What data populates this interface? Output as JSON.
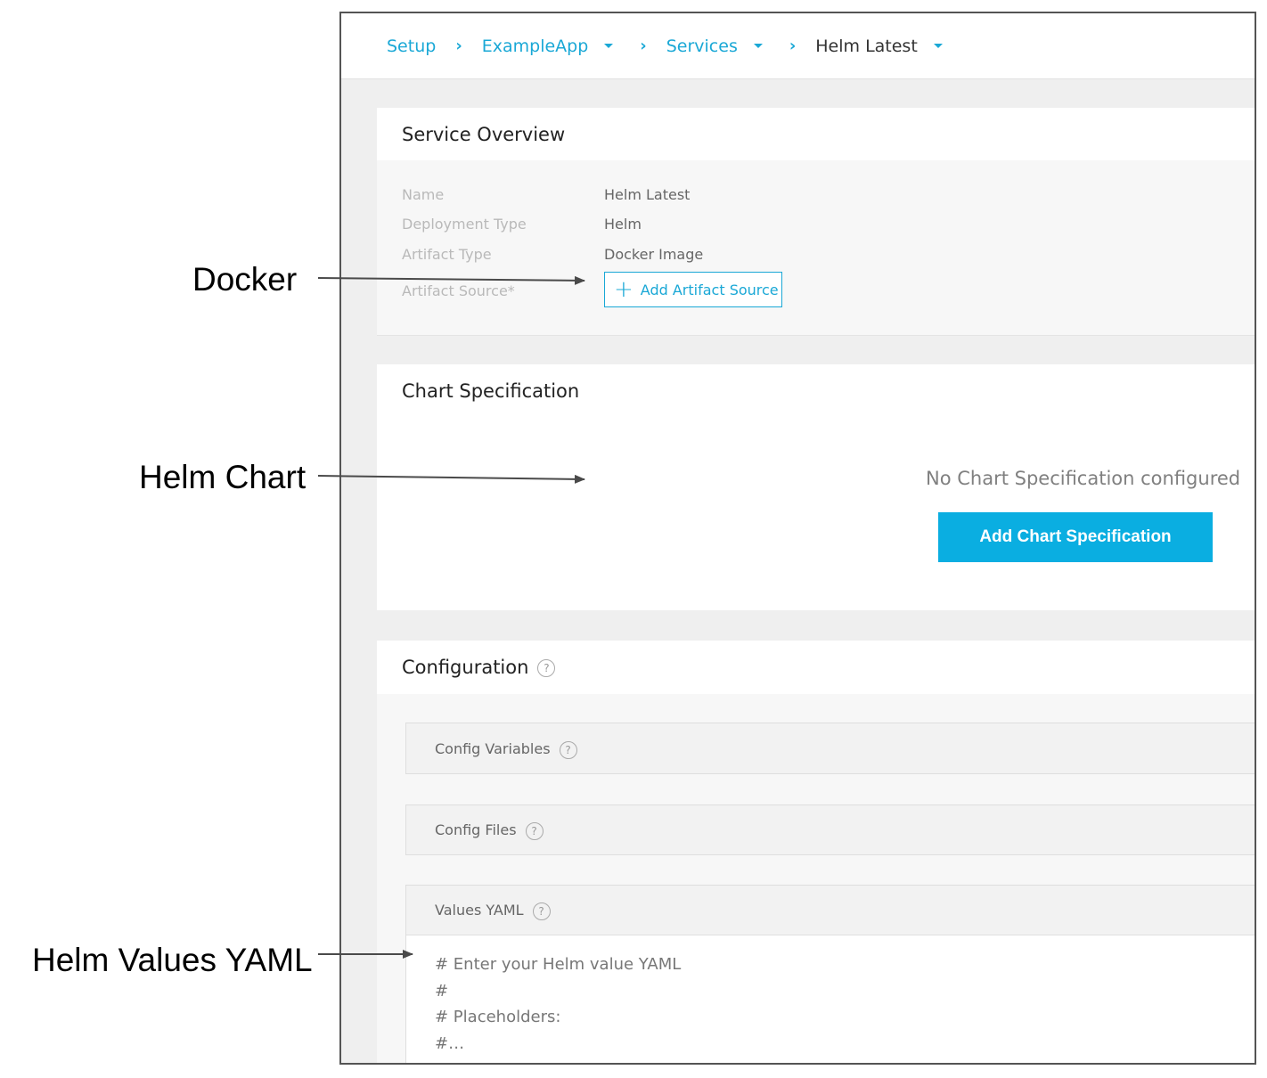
{
  "callouts": {
    "docker": "Docker",
    "helm_chart": "Helm Chart",
    "helm_values": "Helm Values YAML"
  },
  "breadcrumb": {
    "setup": "Setup",
    "app": "ExampleApp",
    "services": "Services",
    "current": "Helm Latest"
  },
  "service_overview": {
    "title": "Service Overview",
    "rows": [
      {
        "label": "Name",
        "value": "Helm Latest"
      },
      {
        "label": "Deployment Type",
        "value": "Helm"
      },
      {
        "label": "Artifact Type",
        "value": "Docker Image"
      },
      {
        "label": "Artifact Source*"
      }
    ],
    "add_artifact_label": "Add Artifact Source"
  },
  "chart_spec": {
    "title": "Chart Specification",
    "empty_text": "No Chart Specification configured",
    "add_button": "Add Chart Specification"
  },
  "configuration": {
    "title": "Configuration",
    "help_glyph": "?",
    "config_variables": "Config Variables",
    "config_files": "Config Files",
    "values_yaml": "Values YAML",
    "yaml_lines": [
      "# Enter your Helm value YAML",
      "#",
      "# Placeholders:",
      "#…"
    ]
  },
  "colors": {
    "accent": "#1aa8d6",
    "primary_button": "#0aaee1",
    "page_bg": "#efefef"
  }
}
